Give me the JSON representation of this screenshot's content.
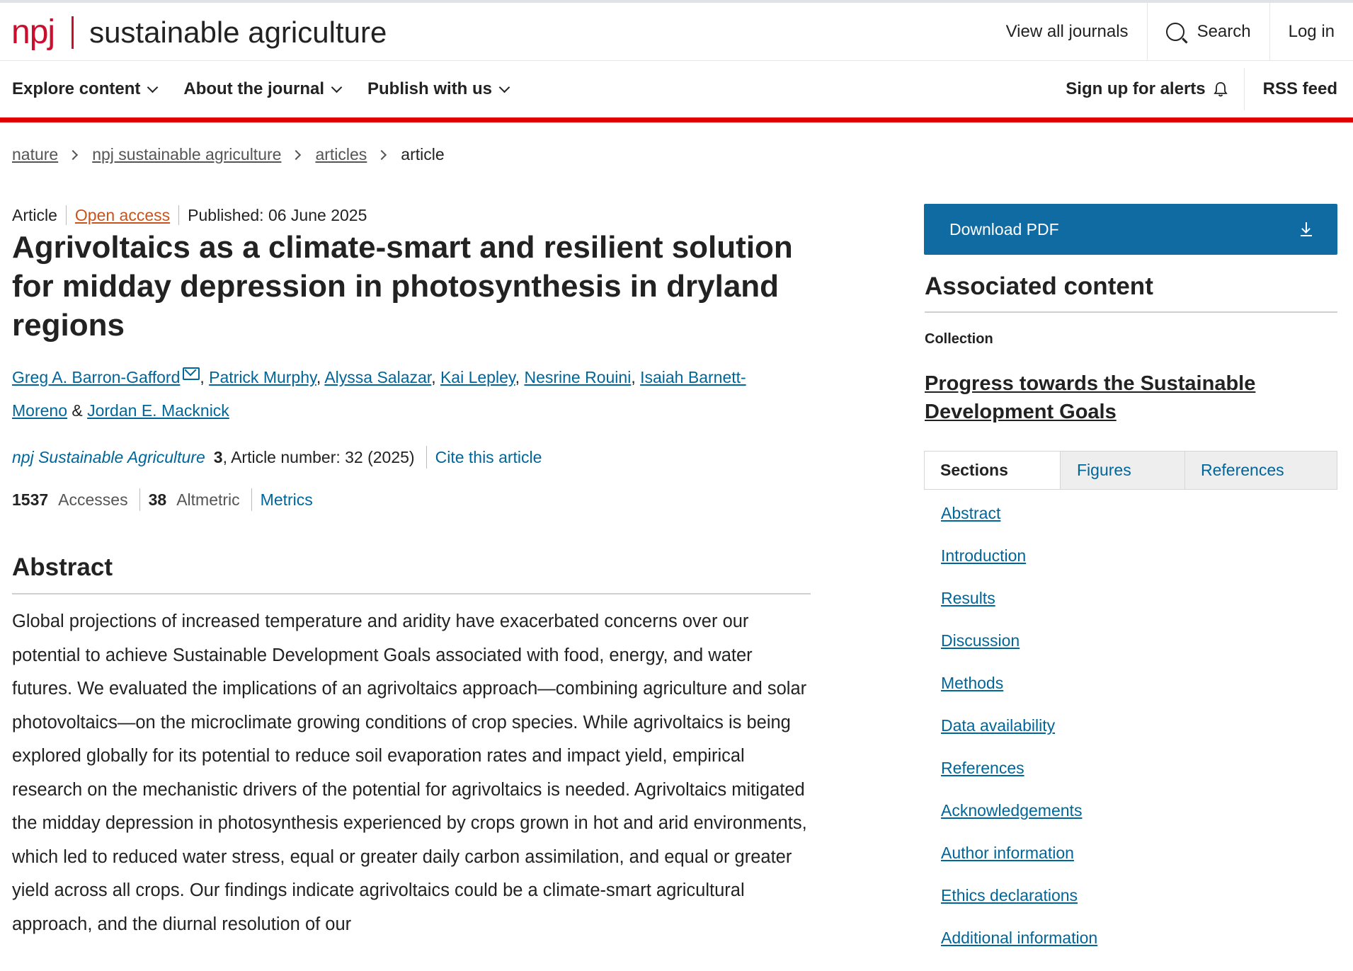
{
  "header": {
    "brand_npj": "npj",
    "brand_name": "sustainable agriculture",
    "view_all_journals": "View all journals",
    "search_label": "Search",
    "login_label": "Log in"
  },
  "nav": {
    "items": [
      "Explore content",
      "About the journal",
      "Publish with us"
    ],
    "sign_up_alerts": "Sign up for alerts",
    "rss_feed": "RSS feed"
  },
  "breadcrumb": {
    "items": [
      "nature",
      "npj sustainable agriculture",
      "articles"
    ],
    "current": "article"
  },
  "article": {
    "type": "Article",
    "access": "Open access",
    "published": "Published: 06 June 2025",
    "title": "Agrivoltaics as a climate-smart and resilient solution for midday depression in photosynthesis in dryland regions",
    "authors": [
      "Greg A. Barron-Gafford",
      "Patrick Murphy",
      "Alyssa Salazar",
      "Kai Lepley",
      "Nesrine Rouini",
      "Isaiah Barnett-Moreno",
      "Jordan E. Macknick"
    ],
    "journal_name": "npj Sustainable Agriculture",
    "volume": "3",
    "article_number_text": ", Article number: 32 (2025)",
    "cite_label": "Cite this article",
    "accesses_count": "1537",
    "accesses_label": "Accesses",
    "altmetric_count": "38",
    "altmetric_label": "Altmetric",
    "metrics_label": "Metrics"
  },
  "abstract": {
    "heading": "Abstract",
    "text": "Global projections of increased temperature and aridity have exacerbated concerns over our potential to achieve Sustainable Development Goals associated with food, energy, and water futures. We evaluated the implications of an agrivoltaics approach—combining agriculture and solar photovoltaics—on the microclimate growing conditions of crop species. While agrivoltaics is being explored globally for its potential to reduce soil evaporation rates and impact yield, empirical research on the mechanistic drivers of the potential for agrivoltaics is needed. Agrivoltaics mitigated the midday depression in photosynthesis experienced by crops grown in hot and arid environments, which led to reduced water stress, equal or greater daily carbon assimilation, and equal or greater yield across all crops. Our findings indicate agrivoltaics could be a climate-smart agricultural approach, and the diurnal resolution of our"
  },
  "sidebar": {
    "download_pdf": "Download PDF",
    "associated_heading": "Associated content",
    "collection_label": "Collection",
    "collection_title": "Progress towards the Sustainable Development Goals",
    "tabs": [
      "Sections",
      "Figures",
      "References"
    ],
    "sections": [
      "Abstract",
      "Introduction",
      "Results",
      "Discussion",
      "Methods",
      "Data availability",
      "References",
      "Acknowledgements",
      "Author information",
      "Ethics declarations",
      "Additional information"
    ]
  },
  "colors": {
    "brand_red": "#c8102e",
    "nav_rule_red": "#e00000",
    "link_blue": "#006699",
    "button_blue": "#0f6ba1",
    "open_access_orange": "#c7541b"
  }
}
